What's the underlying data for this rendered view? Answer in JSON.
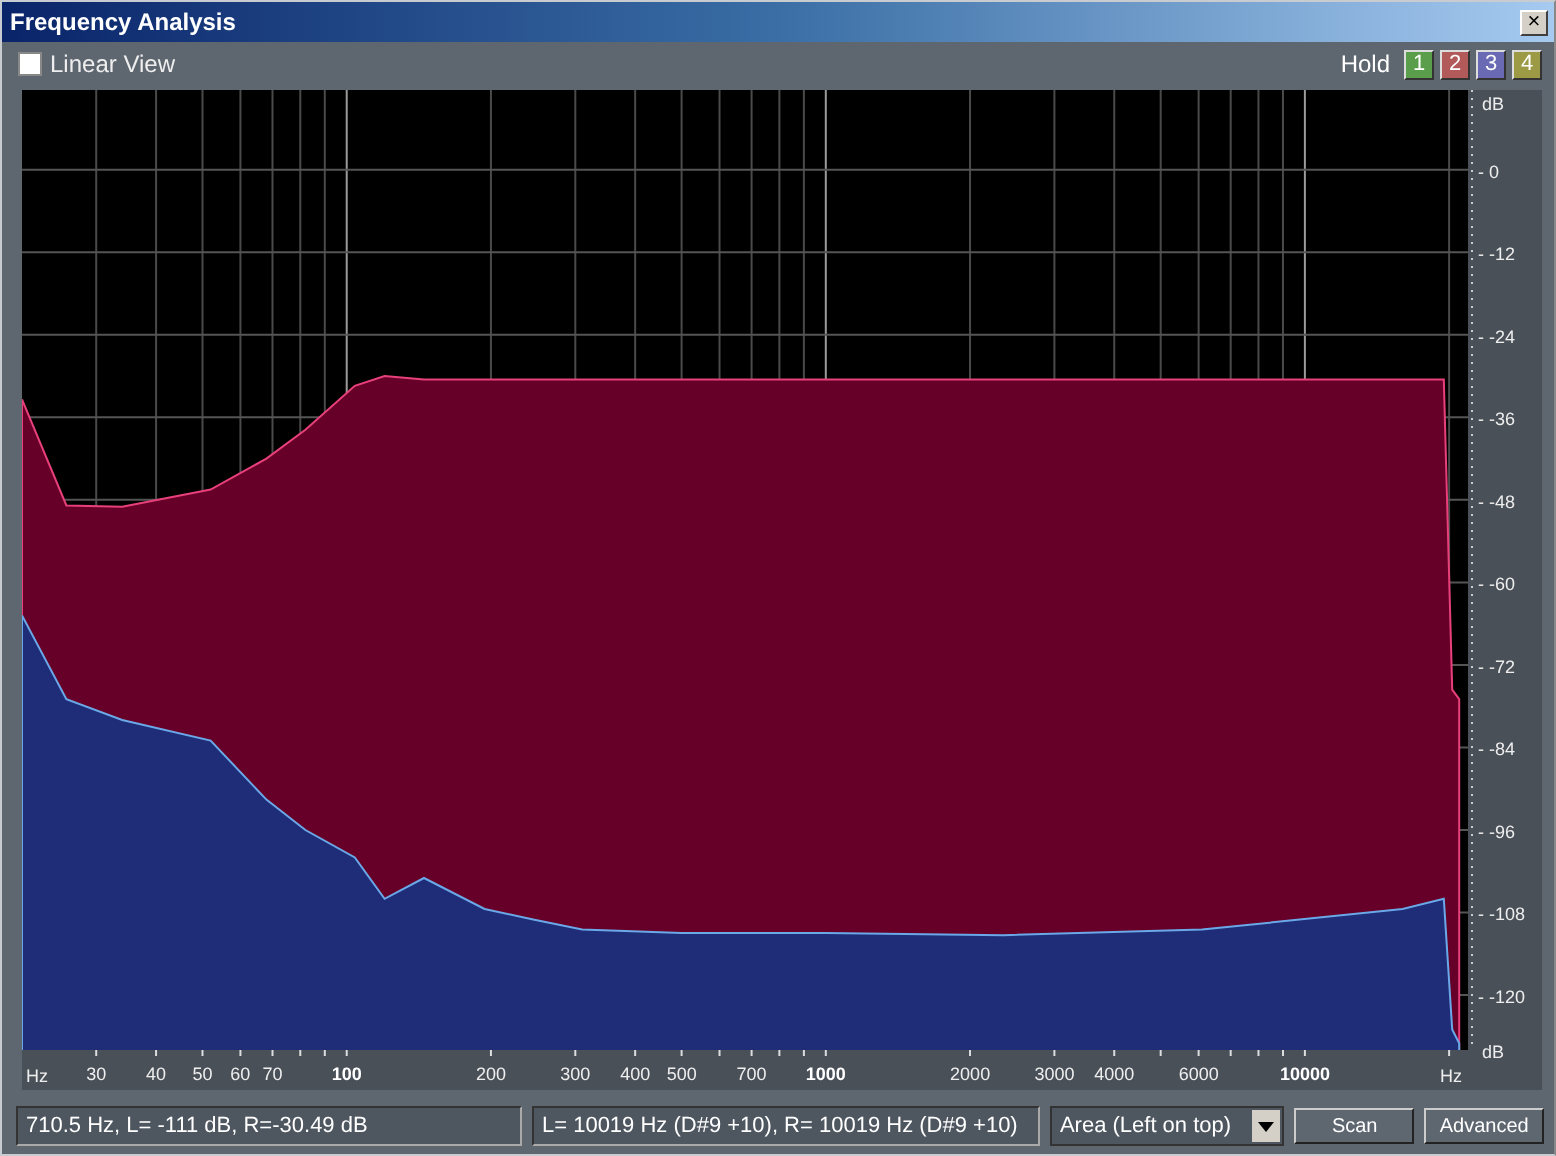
{
  "window": {
    "title": "Frequency Analysis",
    "close": "×"
  },
  "toolbar": {
    "linear_view": {
      "label": "Linear View",
      "checked": false
    },
    "hold_label": "Hold",
    "hold_buttons": [
      {
        "label": "1",
        "color": "#5a9e4c"
      },
      {
        "label": "2",
        "color": "#b25a5a"
      },
      {
        "label": "3",
        "color": "#6a6ab4"
      },
      {
        "label": "4",
        "color": "#9c9a44"
      }
    ]
  },
  "spectrum": {
    "kind": "picture",
    "frequency_labels": [
      "30",
      "40",
      "50",
      "60",
      "70",
      "100",
      "200",
      "300",
      "400",
      "500",
      "700",
      "1000",
      "2000",
      "3000",
      "4000",
      "6000",
      "10000"
    ],
    "level_labels": [
      "- 0",
      "- -12",
      "- -24",
      "- -36",
      "- -48",
      "- -60",
      "- -72",
      "- -84",
      "- -96",
      "- -108",
      "- -120"
    ],
    "x_unit_labels": [
      "Hz",
      "Hz"
    ],
    "y_unit_labels": [
      "dB",
      "dB"
    ]
  },
  "status_bar": {
    "cursor_reading": "710.5 Hz, L=  -111 dB, R=-30.49 dB",
    "peak_reading": "L=  10019 Hz (D#9 +10), R=  10019 Hz (D#9 +10)",
    "view_mode": "Area (Left on top)",
    "buttons": [
      "Scan",
      "Advanced"
    ]
  }
}
